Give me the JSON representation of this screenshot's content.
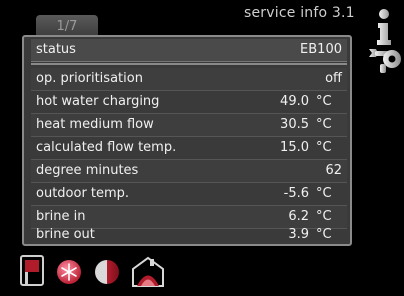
{
  "header": {
    "page_indicator": "1/7",
    "title": "service info 3.1"
  },
  "status": {
    "label": "status",
    "value": "EB100"
  },
  "rows": [
    {
      "label": "op. prioritisation",
      "value": "off",
      "unit": ""
    },
    {
      "label": "hot water charging",
      "value": "49.0",
      "unit": "°C"
    },
    {
      "label": "heat medium flow",
      "value": "30.5",
      "unit": "°C"
    },
    {
      "label": "calculated flow temp.",
      "value": "15.0",
      "unit": "°C"
    },
    {
      "label": "degree minutes",
      "value": "62",
      "unit": ""
    },
    {
      "label": "outdoor temp.",
      "value": "-5.6",
      "unit": "°C"
    },
    {
      "label": "brine in",
      "value": "6.2",
      "unit": "°C"
    },
    {
      "label": "brine out",
      "value": "3.9",
      "unit": "°C"
    }
  ],
  "icons": {
    "side": [
      "info-icon",
      "tools-icon"
    ],
    "bottom": [
      "indoor-climate-icon",
      "hot-water-icon",
      "heat-pump-icon",
      "installation-icon"
    ]
  }
}
